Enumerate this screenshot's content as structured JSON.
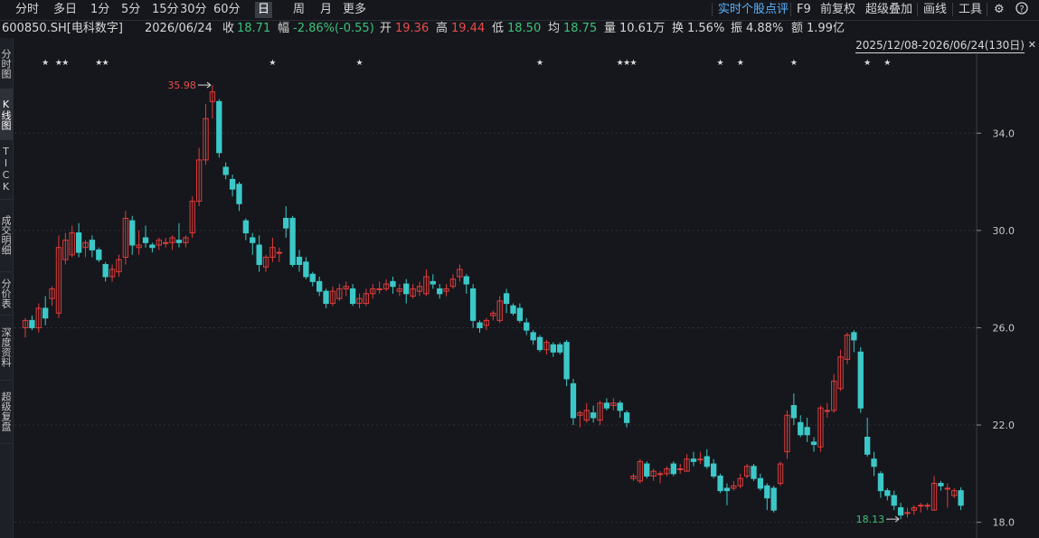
{
  "toolbar": {
    "periods": [
      "分时",
      "多日",
      "1分",
      "5分",
      "15分",
      "30分",
      "60分",
      "日",
      "周",
      "月",
      "更多"
    ],
    "active_period": "日",
    "right_items": [
      "实时个股点评",
      "F9",
      "前复权",
      "超级叠加",
      "画线",
      "工具"
    ],
    "settings_icon": "gear-icon",
    "help_icon": "question-icon"
  },
  "info": {
    "code": "600850.SH[电科数字]",
    "date": "2026/06/24",
    "close_label": "收",
    "close": "18.71",
    "change_label": "幅",
    "change": "-2.86%(-0.55)",
    "open_label": "开",
    "open": "19.36",
    "high_label": "高",
    "high": "19.44",
    "low_label": "低",
    "low": "18.50",
    "avg_label": "均",
    "avg": "18.75",
    "vol_label": "量",
    "vol": "10.61万",
    "turnover_label": "换",
    "turnover": "1.56%",
    "amplitude_label": "振",
    "amplitude": "4.88%",
    "amount_label": "额",
    "amount": "1.99亿"
  },
  "range_label": "2025/12/08-2026/06/24(130日)",
  "sidebar": [
    "分时图",
    "K线图",
    "TICK",
    "成交明细",
    "分价表",
    "深度资料",
    "超级复盘"
  ],
  "colors": {
    "up": "#e03c3c",
    "down": "#3cc8c8",
    "bg": "#15171c",
    "grid": "#2e3138"
  },
  "chart_data": {
    "type": "candlestick",
    "ylim": [
      17.8,
      36.8
    ],
    "yticks": [
      "34.0",
      "30.0",
      "26.0",
      "22.0",
      "18.0"
    ],
    "high_marker": "35.98",
    "low_marker": "18.13",
    "star_marker": "★",
    "star_days": [
      3,
      5,
      6,
      11,
      12,
      37,
      50,
      77,
      89,
      90,
      91,
      104,
      107,
      115,
      126,
      129
    ],
    "candles": [
      [
        26.0,
        26.3,
        26.4,
        25.6
      ],
      [
        26.3,
        26.0,
        26.5,
        25.9
      ],
      [
        26.0,
        26.8,
        27.0,
        25.8
      ],
      [
        26.8,
        26.4,
        27.3,
        26.1
      ],
      [
        27.2,
        27.6,
        27.7,
        26.9
      ],
      [
        26.6,
        29.3,
        29.8,
        26.4
      ],
      [
        28.8,
        29.6,
        29.9,
        28.6
      ],
      [
        29.0,
        29.9,
        30.2,
        28.9
      ],
      [
        29.9,
        29.1,
        30.3,
        28.9
      ],
      [
        29.3,
        29.5,
        29.6,
        28.9
      ],
      [
        29.6,
        29.2,
        29.8,
        28.9
      ],
      [
        29.2,
        28.8,
        29.3,
        28.7
      ],
      [
        28.6,
        28.1,
        28.7,
        27.9
      ],
      [
        28.1,
        28.4,
        28.6,
        27.9
      ],
      [
        28.3,
        28.8,
        29.0,
        28.1
      ],
      [
        28.9,
        30.5,
        30.8,
        28.6
      ],
      [
        30.4,
        29.4,
        30.6,
        29.0
      ],
      [
        29.3,
        29.4,
        30.0,
        29.0
      ],
      [
        29.7,
        29.5,
        30.2,
        29.3
      ],
      [
        29.4,
        29.3,
        29.5,
        29.1
      ],
      [
        29.4,
        29.6,
        29.7,
        29.2
      ],
      [
        29.5,
        29.5,
        29.7,
        29.3
      ],
      [
        29.5,
        29.7,
        29.8,
        29.2
      ],
      [
        29.6,
        29.5,
        30.3,
        29.3
      ],
      [
        29.5,
        29.7,
        29.8,
        29.3
      ],
      [
        29.9,
        31.2,
        31.4,
        29.7
      ],
      [
        31.2,
        32.9,
        33.4,
        31.0
      ],
      [
        32.9,
        34.6,
        35.2,
        32.7
      ],
      [
        35.3,
        35.7,
        35.98,
        34.6
      ],
      [
        35.3,
        33.2,
        35.4,
        33.0
      ],
      [
        32.6,
        32.3,
        32.8,
        32.1
      ],
      [
        32.1,
        31.7,
        32.3,
        31.4
      ],
      [
        31.9,
        31.1,
        32.0,
        30.8
      ],
      [
        30.4,
        29.9,
        30.5,
        29.6
      ],
      [
        29.7,
        29.5,
        29.9,
        29.0
      ],
      [
        29.4,
        28.6,
        29.8,
        28.3
      ],
      [
        28.5,
        28.9,
        29.0,
        28.3
      ],
      [
        28.9,
        29.3,
        29.7,
        28.7
      ],
      [
        29.1,
        29.1,
        29.3,
        28.7
      ],
      [
        30.5,
        30.1,
        31.0,
        29.7
      ],
      [
        30.5,
        28.6,
        30.6,
        28.5
      ],
      [
        28.9,
        28.6,
        29.2,
        28.3
      ],
      [
        28.7,
        28.1,
        28.9,
        28.0
      ],
      [
        28.2,
        27.9,
        28.3,
        27.7
      ],
      [
        27.9,
        27.5,
        28.1,
        27.3
      ],
      [
        27.5,
        27.0,
        27.6,
        26.8
      ],
      [
        27.0,
        27.5,
        27.7,
        26.9
      ],
      [
        27.2,
        27.6,
        27.8,
        27.1
      ],
      [
        27.6,
        27.7,
        27.9,
        27.3
      ],
      [
        27.6,
        27.0,
        27.8,
        26.9
      ],
      [
        27.0,
        27.2,
        27.4,
        26.8
      ],
      [
        27.0,
        27.4,
        27.6,
        26.9
      ],
      [
        27.4,
        27.6,
        27.8,
        27.2
      ],
      [
        27.6,
        27.6,
        27.9,
        27.4
      ],
      [
        27.6,
        27.8,
        28.0,
        27.5
      ],
      [
        27.9,
        27.7,
        28.1,
        27.4
      ],
      [
        27.5,
        27.6,
        27.8,
        27.3
      ],
      [
        27.8,
        27.4,
        28.0,
        27.0
      ],
      [
        27.3,
        27.6,
        27.8,
        27.2
      ],
      [
        27.5,
        27.7,
        27.9,
        27.3
      ],
      [
        27.4,
        28.1,
        28.4,
        27.3
      ],
      [
        27.9,
        27.8,
        28.2,
        27.6
      ],
      [
        27.6,
        27.4,
        27.8,
        27.2
      ],
      [
        27.5,
        27.6,
        27.8,
        27.3
      ],
      [
        27.7,
        28.0,
        28.2,
        27.6
      ],
      [
        28.1,
        28.4,
        28.6,
        27.9
      ],
      [
        28.1,
        27.8,
        28.2,
        27.4
      ],
      [
        27.6,
        26.3,
        27.8,
        26.0
      ],
      [
        26.2,
        26.0,
        26.3,
        25.8
      ],
      [
        26.1,
        26.3,
        26.4,
        25.9
      ],
      [
        26.5,
        26.6,
        26.7,
        26.3
      ],
      [
        26.3,
        27.1,
        27.3,
        26.2
      ],
      [
        27.4,
        27.0,
        27.6,
        26.6
      ],
      [
        26.9,
        26.6,
        27.0,
        26.5
      ],
      [
        26.8,
        26.3,
        27.0,
        26.2
      ],
      [
        26.2,
        25.9,
        26.4,
        25.7
      ],
      [
        25.8,
        25.5,
        25.9,
        25.3
      ],
      [
        25.6,
        25.1,
        25.7,
        25.0
      ],
      [
        25.1,
        25.4,
        25.5,
        24.9
      ],
      [
        25.3,
        25.0,
        25.4,
        24.8
      ],
      [
        25.3,
        25.0,
        25.4,
        24.9
      ],
      [
        25.4,
        23.9,
        25.5,
        23.6
      ],
      [
        23.7,
        22.3,
        23.9,
        22.0
      ],
      [
        22.4,
        22.5,
        22.6,
        21.9
      ],
      [
        22.2,
        22.6,
        22.9,
        22.1
      ],
      [
        22.5,
        22.3,
        22.8,
        22.1
      ],
      [
        22.2,
        22.9,
        23.0,
        22.0
      ],
      [
        22.9,
        22.7,
        23.1,
        22.6
      ],
      [
        22.8,
        22.9,
        23.1,
        22.6
      ],
      [
        22.9,
        22.6,
        23.0,
        22.3
      ],
      [
        22.5,
        22.1,
        22.6,
        21.9
      ],
      [
        19.8,
        19.9,
        20.0,
        19.7
      ],
      [
        19.7,
        20.5,
        20.6,
        19.6
      ],
      [
        20.4,
        19.9,
        20.5,
        19.8
      ],
      [
        19.9,
        20.1,
        20.2,
        19.7
      ],
      [
        20.0,
        20.0,
        20.1,
        19.6
      ],
      [
        20.0,
        20.2,
        20.3,
        19.9
      ],
      [
        20.4,
        20.0,
        20.5,
        19.9
      ],
      [
        20.2,
        20.2,
        20.4,
        20.0
      ],
      [
        20.1,
        20.6,
        20.8,
        20.1
      ],
      [
        20.6,
        20.5,
        20.9,
        20.3
      ],
      [
        20.6,
        20.6,
        20.9,
        20.4
      ],
      [
        20.7,
        20.3,
        21.0,
        20.2
      ],
      [
        20.4,
        19.9,
        20.6,
        19.8
      ],
      [
        19.9,
        19.3,
        20.0,
        19.2
      ],
      [
        19.4,
        19.3,
        19.6,
        18.7
      ],
      [
        19.4,
        19.5,
        19.7,
        19.3
      ],
      [
        19.5,
        19.8,
        20.0,
        19.4
      ],
      [
        19.9,
        20.3,
        20.4,
        19.8
      ],
      [
        20.3,
        19.8,
        20.4,
        19.7
      ],
      [
        19.8,
        19.4,
        20.0,
        19.3
      ],
      [
        19.5,
        19.0,
        19.6,
        18.5
      ],
      [
        19.4,
        18.5,
        19.5,
        18.4
      ],
      [
        19.6,
        20.4,
        20.5,
        19.5
      ],
      [
        20.9,
        22.4,
        22.6,
        20.6
      ],
      [
        22.8,
        22.3,
        23.3,
        22.0
      ],
      [
        22.1,
        21.6,
        22.4,
        21.5
      ],
      [
        21.9,
        21.6,
        22.3,
        21.3
      ],
      [
        21.3,
        21.2,
        21.5,
        20.9
      ],
      [
        21.1,
        22.7,
        22.8,
        20.9
      ],
      [
        22.6,
        22.6,
        22.9,
        22.3
      ],
      [
        22.6,
        23.8,
        24.1,
        22.5
      ],
      [
        23.5,
        24.8,
        25.1,
        23.4
      ],
      [
        24.7,
        25.7,
        25.8,
        24.5
      ],
      [
        25.8,
        25.5,
        25.9,
        25.0
      ],
      [
        25.0,
        22.7,
        25.2,
        22.5
      ],
      [
        21.5,
        20.8,
        22.3,
        20.7
      ],
      [
        20.6,
        20.3,
        20.9,
        19.9
      ],
      [
        20.0,
        19.3,
        20.1,
        19.0
      ],
      [
        19.3,
        19.1,
        19.4,
        18.9
      ],
      [
        19.1,
        18.7,
        19.3,
        18.5
      ],
      [
        18.6,
        18.3,
        18.8,
        18.13
      ],
      [
        18.4,
        18.4,
        18.6,
        18.2
      ],
      [
        18.5,
        18.6,
        18.7,
        18.3
      ],
      [
        18.7,
        18.7,
        18.8,
        18.4
      ],
      [
        18.7,
        18.7,
        18.8,
        18.5
      ],
      [
        18.5,
        19.6,
        19.9,
        18.5
      ],
      [
        19.6,
        19.5,
        19.7,
        19.3
      ],
      [
        19.4,
        19.4,
        19.6,
        18.6
      ],
      [
        19.1,
        19.3,
        19.4,
        19.0
      ],
      [
        19.3,
        18.7,
        19.44,
        18.5
      ]
    ]
  }
}
